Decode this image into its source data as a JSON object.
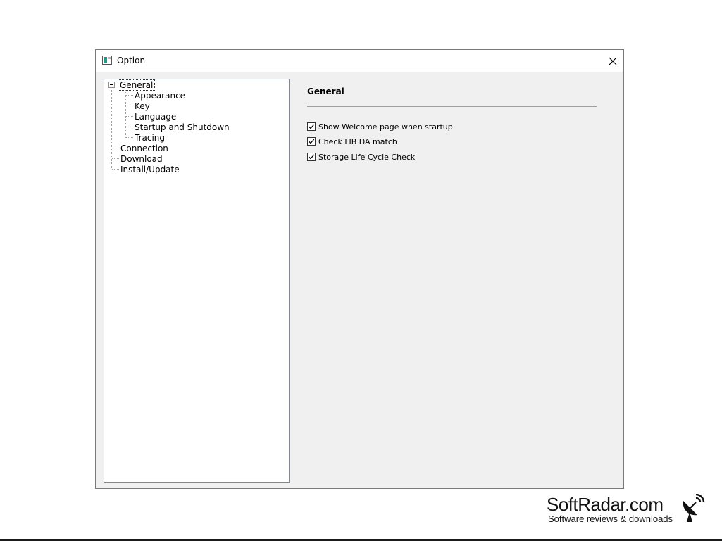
{
  "window": {
    "title": "Option"
  },
  "tree": {
    "items": [
      {
        "label": "General"
      },
      {
        "label": "Appearance"
      },
      {
        "label": "Key"
      },
      {
        "label": "Language"
      },
      {
        "label": "Startup and Shutdown"
      },
      {
        "label": "Tracing"
      },
      {
        "label": "Connection"
      },
      {
        "label": "Download"
      },
      {
        "label": "Install/Update"
      }
    ],
    "selected": "General"
  },
  "panel": {
    "title": "General",
    "options": [
      {
        "label": "Show Welcome page when startup",
        "checked": true
      },
      {
        "label": "Check LIB DA match",
        "checked": true
      },
      {
        "label": "Storage Life Cycle Check",
        "checked": true
      }
    ]
  },
  "watermark": {
    "title": "SoftRadar.com",
    "subtitle": "Software reviews & downloads"
  }
}
